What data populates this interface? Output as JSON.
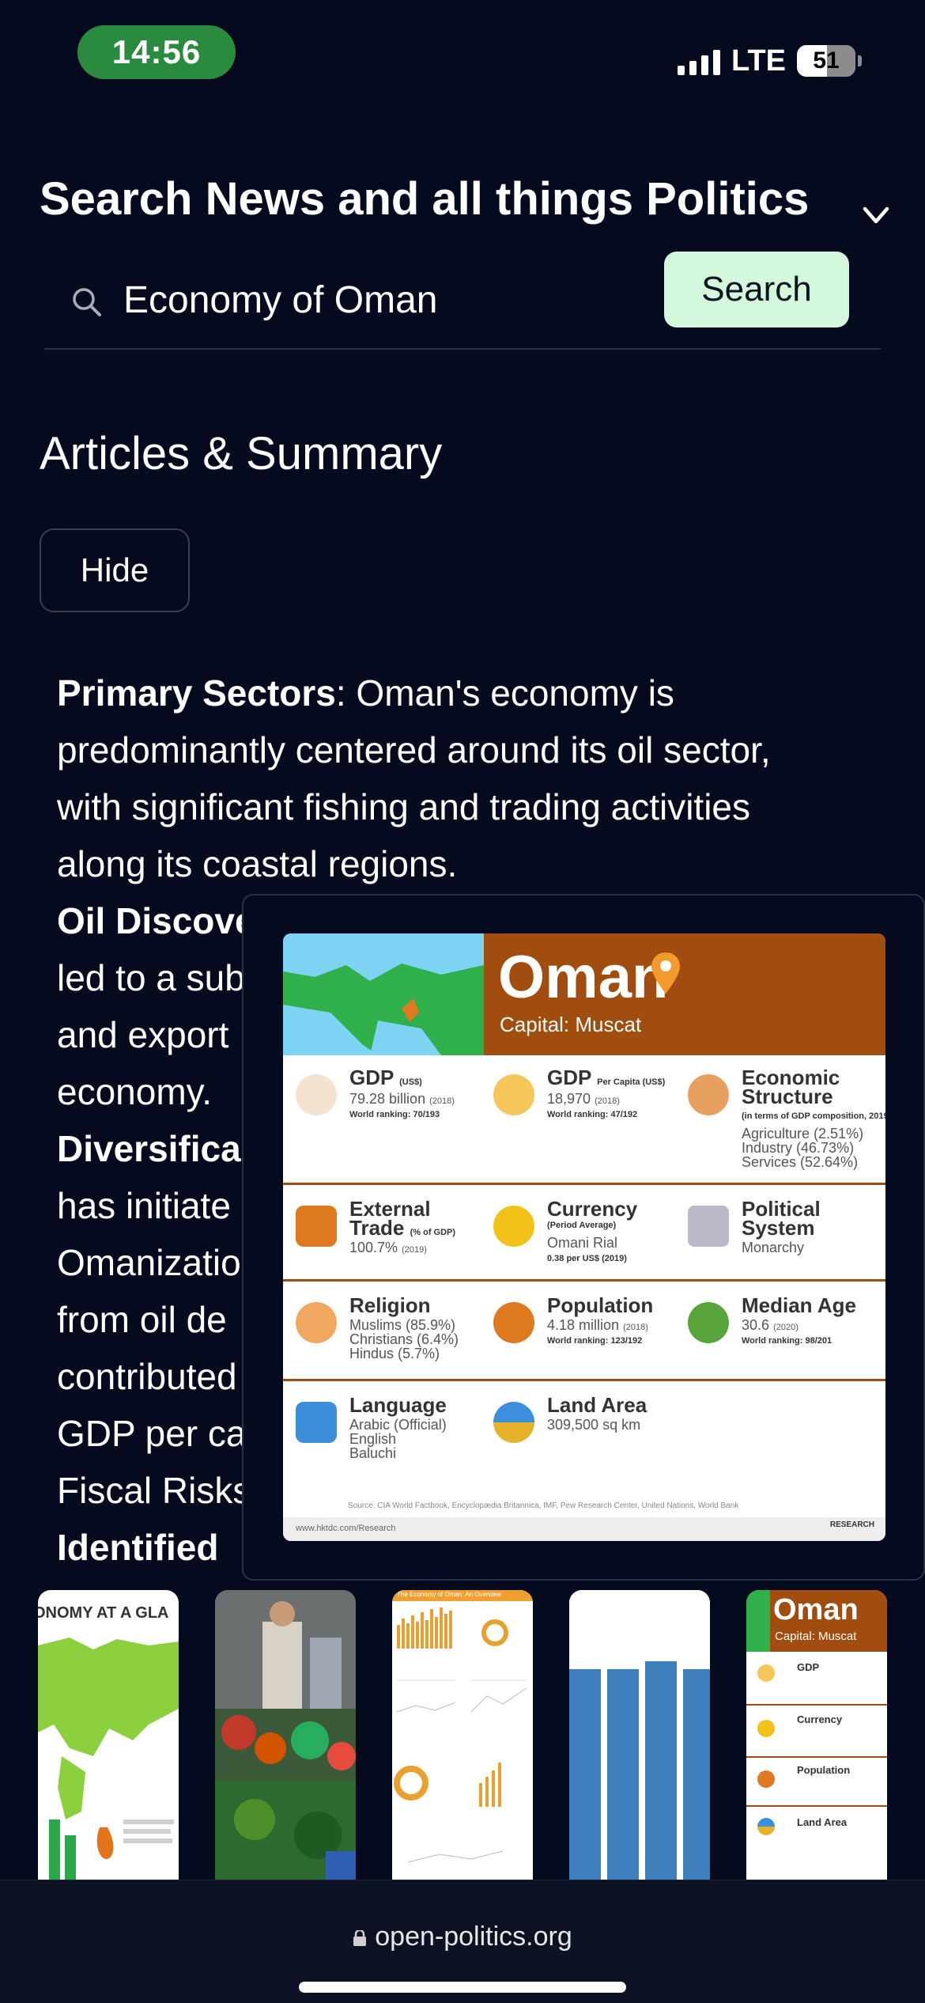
{
  "status_bar": {
    "time": "14:56",
    "network": "LTE",
    "battery": "51"
  },
  "header": {
    "title": "Search News and all things Politics",
    "collapse_icon": "chevron-down-icon"
  },
  "search": {
    "value": "Economy of Oman",
    "button_label": "Search",
    "icon": "search-icon"
  },
  "section": {
    "title": "Articles & Summary",
    "hide_label": "Hide"
  },
  "article_lines": [
    {
      "bold": "Primary Sectors",
      "text": ": Oman's economy is"
    },
    {
      "bold": "",
      "text": "predominantly centered around its oil sector,"
    },
    {
      "bold": "",
      "text": "with significant fishing and trading activities"
    },
    {
      "bold": "",
      "text": "along its coastal regions."
    },
    {
      "bold": "Oil Discove",
      "text": ""
    },
    {
      "bold": "",
      "text": "led to a sub"
    },
    {
      "bold": "",
      "text": "and export"
    },
    {
      "bold": "",
      "text": "economy."
    },
    {
      "bold": "Diversifica",
      "text": ""
    },
    {
      "bold": "",
      "text": "has initiate"
    },
    {
      "bold": "",
      "text": "Omanizatio"
    },
    {
      "bold": "",
      "text": "from oil de"
    },
    {
      "bold": "",
      "text": "contributed"
    },
    {
      "bold": "",
      "text": "GDP per ca"
    },
    {
      "bold": "",
      "text": "Fiscal Risks"
    },
    {
      "bold": "Identified",
      "text": ""
    }
  ],
  "infographic": {
    "title": "Oman",
    "capital": "Capital: Muscat",
    "gdp": {
      "label": "GDP",
      "unit": "(US$)",
      "value": "79.28 billion",
      "year": "(2018)",
      "rank": "World ranking: 70/193"
    },
    "gdp_per_capita": {
      "label": "GDP",
      "unit": "Per Capita (US$)",
      "value": "18,970",
      "year": "(2018)",
      "rank": "World ranking: 47/192"
    },
    "economic_structure": {
      "label": "Economic Structure",
      "note": "(in terms of GDP composition, 2019)",
      "items": [
        "Agriculture (2.51%)",
        "Industry (46.73%)",
        "Services (52.64%)"
      ]
    },
    "external_trade": {
      "label": "External Trade",
      "unit": "(% of GDP)",
      "value": "100.7%",
      "year": "(2019)"
    },
    "currency": {
      "label": "Currency",
      "note": "(Period Average)",
      "value": "Omani Rial",
      "rate": "0.38 per US$ (2019)"
    },
    "political_system": {
      "label": "Political System",
      "value": "Monarchy"
    },
    "religion": {
      "label": "Religion",
      "items": [
        "Muslims (85.9%)",
        "Christians (6.4%)",
        "Hindus (5.7%)"
      ]
    },
    "population": {
      "label": "Population",
      "value": "4.18 million",
      "year": "(2018)",
      "rank": "World ranking: 123/192"
    },
    "median_age": {
      "label": "Median Age",
      "value": "30.6",
      "year": "(2020)",
      "rank": "World ranking: 98/201"
    },
    "language": {
      "label": "Language",
      "items": [
        "Arabic (Official)",
        "English",
        "Baluchi"
      ]
    },
    "land_area": {
      "label": "Land Area",
      "value": "309,500 sq km"
    },
    "source": "Source: CIA World Factbook, Encyclopædia Britannica, IMF, Pew Research Center, United Nations, World Bank",
    "footer_url": "www.hktdc.com/Research",
    "brand": "RESEARCH"
  },
  "thumbnails": [
    {
      "title": "ONOMY AT A GLA"
    },
    {
      "title": ""
    },
    {
      "title": "The Economy of Oman: An Overview"
    },
    {
      "title": ""
    },
    {
      "title": "Oman",
      "subtitle": "Capital: Muscat",
      "items": [
        "GDP",
        "Currency",
        "Population",
        "Land Area"
      ]
    }
  ],
  "bottom": {
    "url": "open-politics.org"
  },
  "colors": {
    "background": "#050a1e",
    "search_button": "#d4f8dc",
    "status_time": "#2a8a3e",
    "infographic_brown": "#a04d0f",
    "infographic_green": "#2fb04a"
  }
}
